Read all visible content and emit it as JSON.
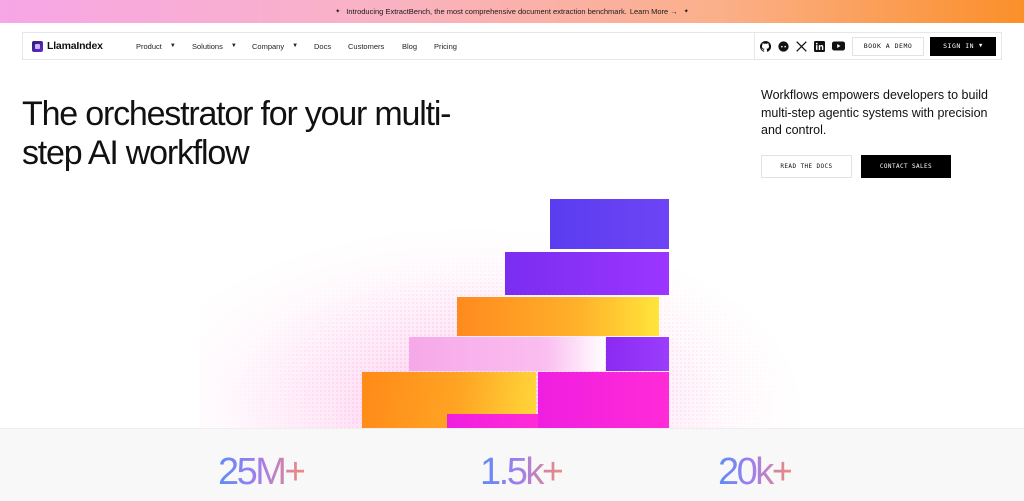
{
  "announcement": {
    "text": "Introducing ExtractBench, the most comprehensive document extraction benchmark.",
    "link": "Learn More →"
  },
  "nav": {
    "logo": "LlamaIndex",
    "menu": [
      {
        "label": "Product",
        "dropdown": true
      },
      {
        "label": "Solutions",
        "dropdown": true
      },
      {
        "label": "Company",
        "dropdown": true
      },
      {
        "label": "Docs",
        "dropdown": false
      },
      {
        "label": "Customers",
        "dropdown": false
      },
      {
        "label": "Blog",
        "dropdown": false
      },
      {
        "label": "Pricing",
        "dropdown": false
      }
    ],
    "social_icons": [
      "github-icon",
      "discord-icon",
      "x-icon",
      "linkedin-icon",
      "youtube-icon"
    ],
    "book_demo": "BOOK A DEMO",
    "sign_in": "SIGN IN"
  },
  "hero": {
    "title": "The orchestrator for your multi-step AI workflow",
    "description": "Workflows empowers developers to build multi-step agentic systems with precision and control.",
    "read_docs": "READ THE DOCS",
    "contact_sales": "CONTACT SALES"
  },
  "stats": [
    "25M+",
    "1.5k+",
    "20k+"
  ],
  "colors": {
    "violet": "#5a3df0",
    "purple": "#9c35ff",
    "orange": "#ff8a1e",
    "yellow": "#ffe53a",
    "pink": "#f6a8e8",
    "magenta": "#ff2bd8"
  }
}
